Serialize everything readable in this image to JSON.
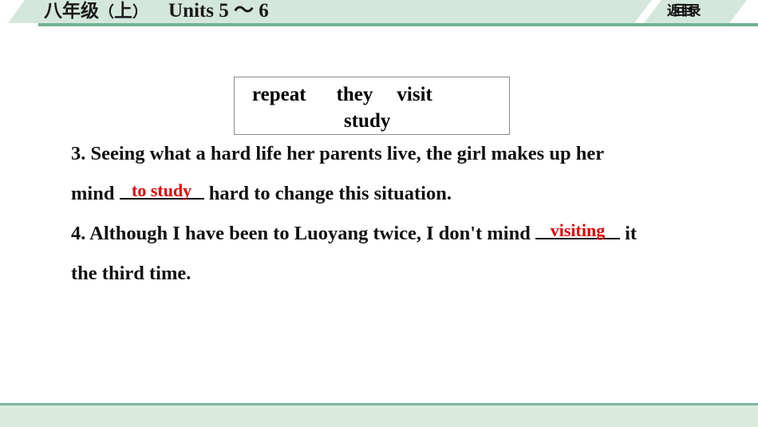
{
  "header": {
    "grade_label": "八年级",
    "paren_open": "（",
    "volume_label": "上",
    "paren_close": "）",
    "units_label": "Units 5 ～ 6",
    "back_button_label": "返回目录",
    "band_color": "#d4e7dc",
    "band_border_color": "#6fb292"
  },
  "word_bank": {
    "line1": {
      "word1": "repeat",
      "word2": "they",
      "word3": "visit"
    },
    "line2": {
      "word1": "study"
    }
  },
  "questions": [
    {
      "number": "3.",
      "line1": "3. Seeing what a hard life her parents live, the girl makes up her",
      "line2_before": "mind ",
      "blank_answer": "to study",
      "line2_after": " hard to change this situation."
    },
    {
      "number": "4.",
      "line1_before": "4. Although I have been to Luoyang twice, I don't mind ",
      "blank_answer": "visiting",
      "line1_after": " it",
      "line2": "the third time."
    }
  ],
  "colors": {
    "answer_red": "#e60000",
    "text_black": "#111111",
    "footer_bg": "#dbeadf",
    "footer_border": "#7cb79a",
    "box_border": "#8c8c8c"
  }
}
